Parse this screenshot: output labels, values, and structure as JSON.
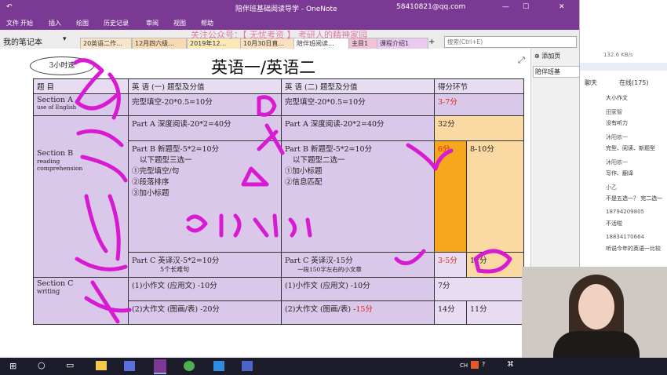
{
  "titlebar": {
    "title": "陪伴班基础阅读导学 - OneNote",
    "account": "58410821@qq.com"
  },
  "ribbon": {
    "tabs": [
      "文件",
      "开始",
      "插入",
      "绘图",
      "历史记录",
      "审阅",
      "视图",
      "帮助"
    ]
  },
  "notebook": {
    "name": "我的笔记本",
    "tabs": [
      "20英语二作...",
      "12月四六级...",
      "2019年12...",
      "10月30日直...",
      "陪伴班阅读...",
      "主目1",
      "课程介绍1"
    ],
    "watermark": "关注公众号：【 无忧考资 】 考研人的精神家园",
    "search_placeholder": "搜索(Ctrl+E)",
    "add_page": "添加页",
    "page_item": "陪伴班基"
  },
  "slide": {
    "badge": "3小时速",
    "title": "英语一/英语二",
    "headers": [
      "题 目",
      "英 语 (一) 题型及分值",
      "英 语 (二) 题型及分值",
      "得分环节"
    ],
    "rows": [
      {
        "sec": "Section A",
        "sec2": "use of English",
        "e1": "完型填空-20*0.5=10分",
        "e2": "完型填空-20*0.5=10分",
        "score": "3-7分"
      },
      {
        "sec": "",
        "sec2": "",
        "e1": "Part A 深度阅读-20*2=40分",
        "e2": "Part A 深度阅读-20*2=40分",
        "score": "32分"
      },
      {
        "sec": "Section B",
        "sec2": "reading comprehension",
        "e1": "Part B 新题型-5*2=10分",
        "e1b": "以下题型三选一",
        "e1c": [
          "①完型填空/句",
          "②段落排序",
          "③加小标题"
        ],
        "e2": "Part B 新题型-5*2=10分",
        "e2b": "以下题型二选一",
        "e2c": [
          "①加小标题",
          "②信息匹配"
        ],
        "score_a": "6分",
        "score_b": "8-10分"
      },
      {
        "sec": "",
        "sec2": "",
        "e1": "Part C 英译汉-5*2=10分",
        "e1b": "5个长难句",
        "e2": "Part C 英译汉-15分",
        "e2b": "一段150字左右的小文章",
        "score_a": "3-5分",
        "score_b": "12分"
      },
      {
        "sec": "Section C",
        "sec2": "writing",
        "e1": "(1)小作文 (应用文) -10分",
        "e2": "(1)小作文 (应用文) -10分",
        "score": "7分"
      },
      {
        "sec": "",
        "sec2": "",
        "e1": "(2)大作文 (图画/表) -20分",
        "e2": "(2)大作文 (图画/表) -",
        "e2r": "15分",
        "score_a": "14分",
        "score_b": "11分"
      }
    ],
    "ink_text": "500-700"
  },
  "chat": {
    "speed": "132.6 KB/s",
    "tabs": [
      "聊天",
      "在线(175)"
    ],
    "messages": [
      {
        "name": "",
        "text": "大小作文"
      },
      {
        "name": "田家智",
        "text": "没有听力"
      },
      {
        "name": "沐阳依一",
        "text": "完型、阅读、新题型"
      },
      {
        "name": "沐阳依一",
        "text": "写作、翻译"
      },
      {
        "name": "小乙",
        "text": "不是五选一？ 完二选一"
      },
      {
        "name": "18794209805",
        "text": "不活啦"
      },
      {
        "name": "18834170664",
        "text": "听说今年的英语一比较"
      }
    ]
  },
  "taskbar": {
    "lang": "CH"
  }
}
